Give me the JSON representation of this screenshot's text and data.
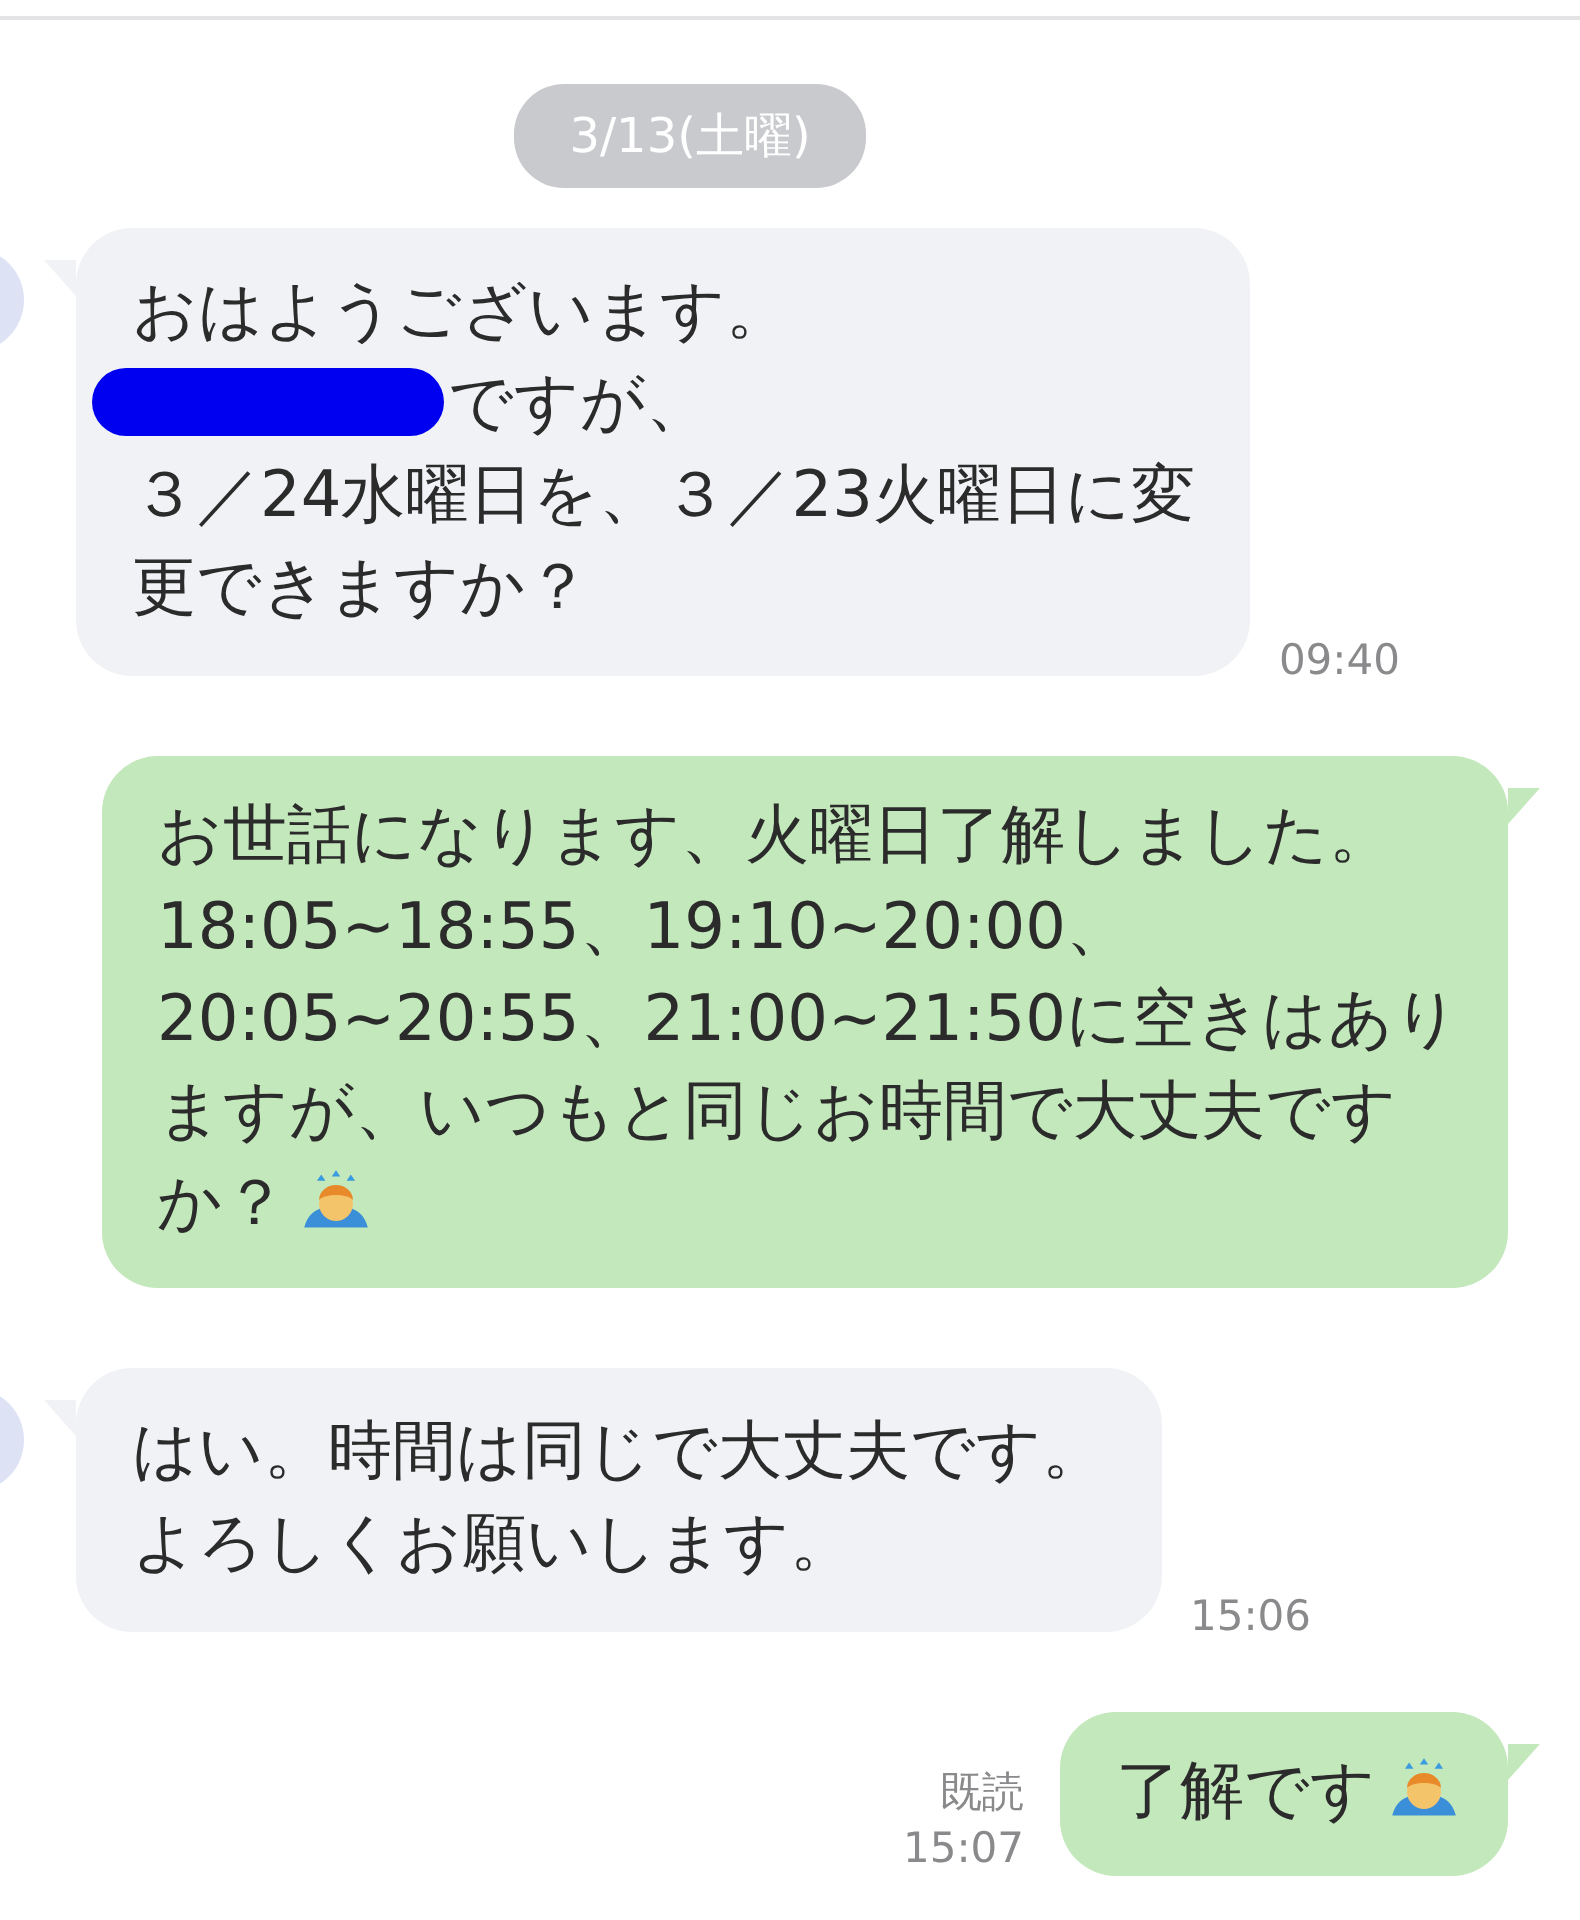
{
  "date_label": "3/13(土曜)",
  "messages": [
    {
      "kind": "incoming",
      "time": "09:40",
      "lines": [
        {
          "kind": "plain",
          "text": "おはようございます。"
        },
        {
          "kind": "redacted",
          "text": "ですが、"
        },
        {
          "kind": "plain",
          "text": "３／24水曜日を、３／23火曜日に変"
        },
        {
          "kind": "plain",
          "text": "更できますか？"
        }
      ]
    },
    {
      "kind": "outgoing",
      "lines": [
        {
          "kind": "plain",
          "text": "お世話になります、火曜日了解しました。"
        },
        {
          "kind": "plain",
          "text": "18:05~18:55、19:10~20:00、"
        },
        {
          "kind": "plain",
          "text": "20:05~20:55、21:00~21:50に空きはあり"
        },
        {
          "kind": "plain",
          "text": "ますが、いつもと同じお時間で大丈夫です"
        },
        {
          "kind": "emoji",
          "text": "か？"
        }
      ]
    },
    {
      "kind": "incoming",
      "time": "15:06",
      "lines": [
        {
          "kind": "plain",
          "text": "はい。時間は同じで大丈夫です。"
        },
        {
          "kind": "plain",
          "text": "よろしくお願いします。"
        }
      ]
    },
    {
      "kind": "outgoing",
      "time": "15:07",
      "read": "既読",
      "lines": [
        {
          "kind": "emoji",
          "text": "了解です"
        }
      ]
    }
  ]
}
